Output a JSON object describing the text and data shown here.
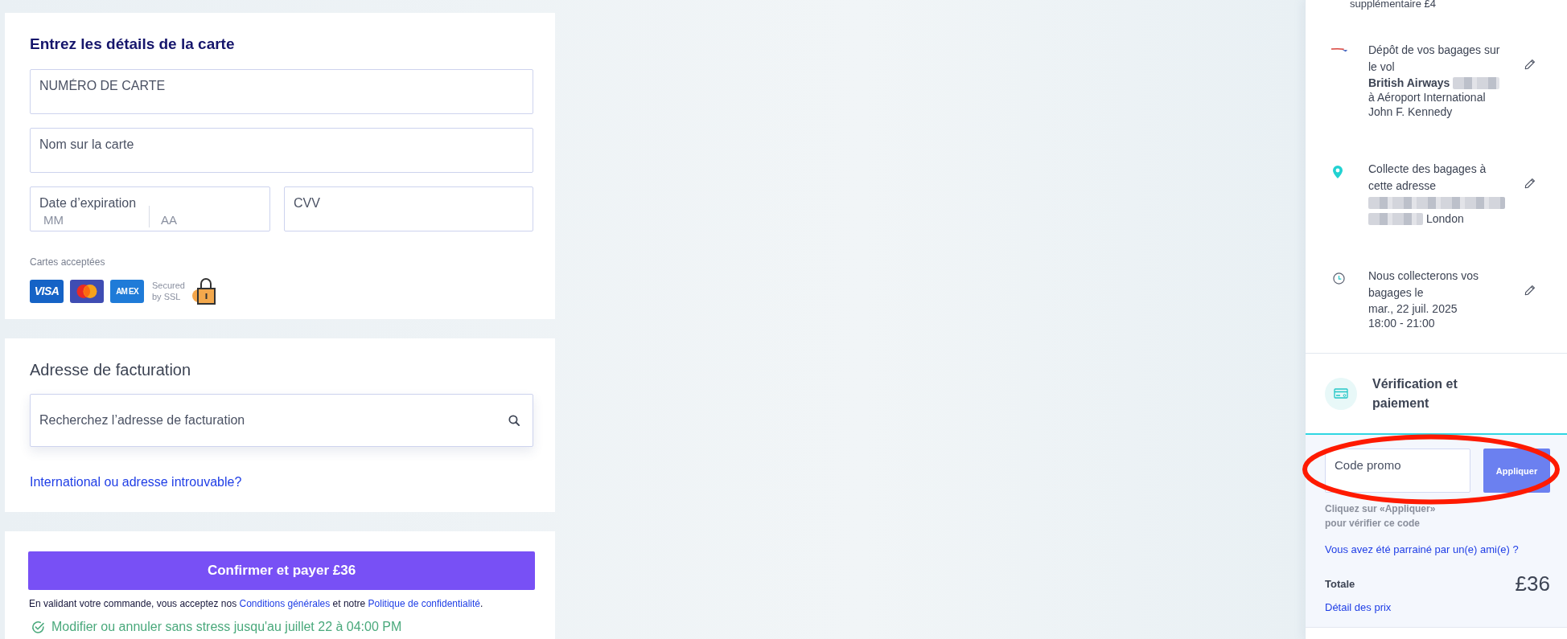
{
  "card_details": {
    "title": "Entrez les détails de la carte",
    "rows": [
      [
        {
          "kind": "text",
          "placeholder": "NUMÉRO DE CARTE"
        }
      ],
      [
        {
          "kind": "text",
          "placeholder": "Nom sur la carte"
        }
      ],
      [
        {
          "kind": "expiry",
          "label": "Date d’expiration",
          "month_placeholder": "MM",
          "year_placeholder": "AA"
        },
        {
          "kind": "text",
          "placeholder": "CVV"
        }
      ]
    ],
    "accepted_label": "Cartes acceptées",
    "card_brands": [
      {
        "kind": "visa",
        "label": "VISA"
      },
      {
        "kind": "mastercard"
      },
      {
        "kind": "amex",
        "label": "AM EX"
      }
    ],
    "ssl_text": "Secured by SSL"
  },
  "billing_address": {
    "title": "Adresse de facturation",
    "search_placeholder": "Recherchez l’adresse de facturation",
    "link": "International ou adresse introuvable?"
  },
  "checkout": {
    "button": "Confirmer et payer £36",
    "terms": {
      "lead": "En validant votre commande, vous acceptez nos ",
      "conditions_link": "Conditions générales",
      "joiner": " et notre ",
      "privacy_link": "Politique de confidentialité",
      "end": "."
    },
    "guarantee": "Modifier ou annuler sans stress jusqu'au juillet 22 à 04:00 PM"
  },
  "summary": {
    "cut_off_text": "supplémentaire £4",
    "items": [
      {
        "kind": "flight",
        "title": "Dépôt de vos bagages sur le vol",
        "details": [
          {
            "kind": "text",
            "text": "British Airways",
            "bold": true,
            "blurred_before": false,
            "blurred_after": true
          },
          {
            "kind": "text",
            "text": "à Aéroport International John F. Kennedy",
            "bold": false,
            "blurred_before": false,
            "blurred_after": false
          }
        ]
      },
      {
        "kind": "address",
        "title": "Collecte des bagages à cette adresse",
        "details": [
          {
            "kind": "blurred"
          },
          {
            "kind": "text",
            "text": "London",
            "bold": false,
            "blurred_before": true,
            "blurred_after": false
          }
        ]
      },
      {
        "kind": "time",
        "title": "Nous collecterons vos bagages le",
        "details": [
          {
            "kind": "text",
            "text": "mar., 22 juil. 2025",
            "bold": false,
            "blurred_before": false,
            "blurred_after": false
          },
          {
            "kind": "text",
            "text": "18:00 - 21:00",
            "bold": false,
            "blurred_before": false,
            "blurred_after": false
          }
        ]
      }
    ],
    "step": {
      "title": "Vérification et paiement",
      "active": true
    },
    "promo": {
      "placeholder": "Code promo",
      "button": "Appliquer",
      "circled": true,
      "hint": "Cliquez sur «Appliquer» pour vérifier ce code",
      "referral_link": "Vous avez été parrainé par un(e) ami(e) ?"
    },
    "total": {
      "label": "Totale",
      "amount": "£36",
      "details_link": "Détail des prix"
    }
  }
}
